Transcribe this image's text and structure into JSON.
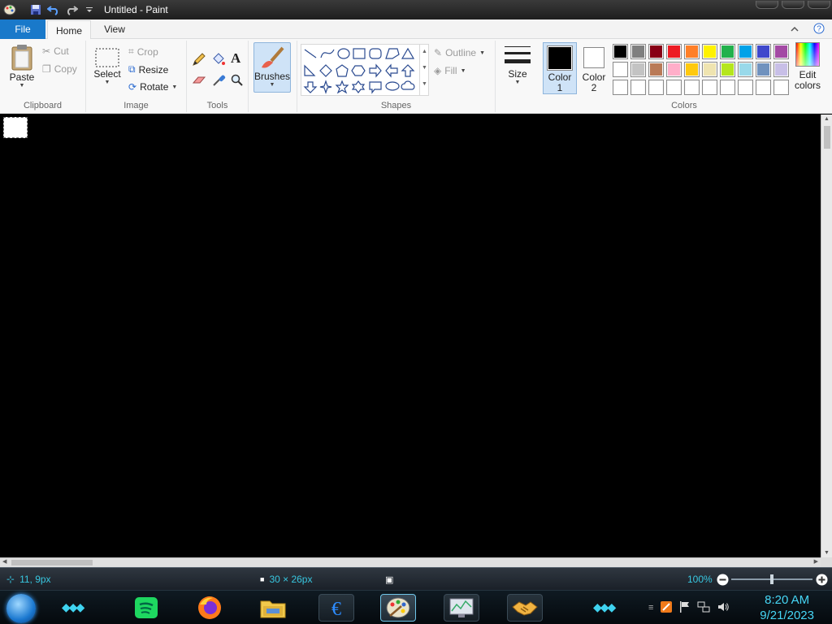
{
  "window": {
    "title": "Untitled - Paint"
  },
  "tabs": {
    "file": "File",
    "home": "Home",
    "view": "View"
  },
  "ribbon": {
    "clipboard": {
      "label": "Clipboard",
      "paste": "Paste",
      "cut": "Cut",
      "copy": "Copy"
    },
    "image": {
      "label": "Image",
      "select": "Select",
      "crop": "Crop",
      "resize": "Resize",
      "rotate": "Rotate"
    },
    "tools": {
      "label": "Tools"
    },
    "brushes": {
      "label": "Brushes"
    },
    "shapes": {
      "label": "Shapes",
      "outline": "Outline",
      "fill": "Fill"
    },
    "size": {
      "label": "Size"
    },
    "color1": {
      "label": "Color",
      "num": "1",
      "value": "#000000"
    },
    "color2": {
      "label": "Color",
      "num": "2",
      "value": "#ffffff"
    },
    "colors": {
      "label": "Colors",
      "edit_line1": "Edit",
      "edit_line2": "colors"
    }
  },
  "palette": {
    "row1": [
      "#000000",
      "#7f7f7f",
      "#880015",
      "#ed1c24",
      "#ff7f27",
      "#fff200",
      "#22b14c",
      "#00a2e8",
      "#3f48cc",
      "#a349a4"
    ],
    "row2": [
      "#ffffff",
      "#c3c3c3",
      "#b97a57",
      "#ffaec9",
      "#ffc90e",
      "#efe4b0",
      "#b5e61d",
      "#99d9ea",
      "#7092be",
      "#c8bfe7"
    ],
    "row3": [
      "#ffffff",
      "#ffffff",
      "#ffffff",
      "#ffffff",
      "#ffffff",
      "#ffffff",
      "#ffffff",
      "#ffffff",
      "#ffffff",
      "#ffffff"
    ]
  },
  "status": {
    "cursor_pos": "11, 9px",
    "selection_size": "30 × 26px",
    "zoom": "100%",
    "zoom_level": 0.5
  },
  "taskbar": {
    "apps": [
      "spotify-app",
      "firefox-app",
      "file-explorer-app",
      "emule-app",
      "paint-app",
      "system-monitor-app",
      "handshake-app"
    ],
    "clock_time": "8:20 AM",
    "clock_date": "9/21/2023"
  }
}
